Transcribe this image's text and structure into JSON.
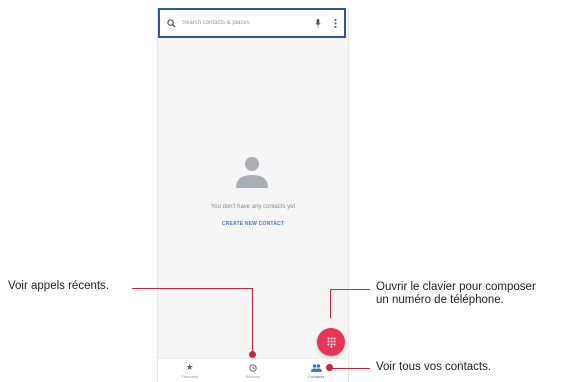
{
  "search": {
    "placeholder": "Search contacts & places",
    "search_icon": "search-icon",
    "mic_icon": "microphone-icon",
    "more_icon": "more-vert-icon"
  },
  "empty_state": {
    "avatar_icon": "person-icon",
    "message": "You don't have any contacts yet",
    "action": "CREATE NEW CONTACT"
  },
  "fab": {
    "icon": "dialpad-icon"
  },
  "bottom_nav": [
    {
      "label": "Favorites",
      "icon": "star-icon"
    },
    {
      "label": "Recents",
      "icon": "clock-icon"
    },
    {
      "label": "Contacts",
      "icon": "people-icon",
      "active": true
    }
  ],
  "annotations": {
    "recents": "Voir appels récents.",
    "dialpad_line1": "Ouvrir le clavier pour composer",
    "dialpad_line2": "un numéro de téléphone.",
    "contacts": "Voir tous vos contacts."
  },
  "colors": {
    "accent_red": "#e5365a",
    "callout": "#c8233f",
    "link_blue": "#4a78c8",
    "highlight_border": "#2f5597"
  }
}
